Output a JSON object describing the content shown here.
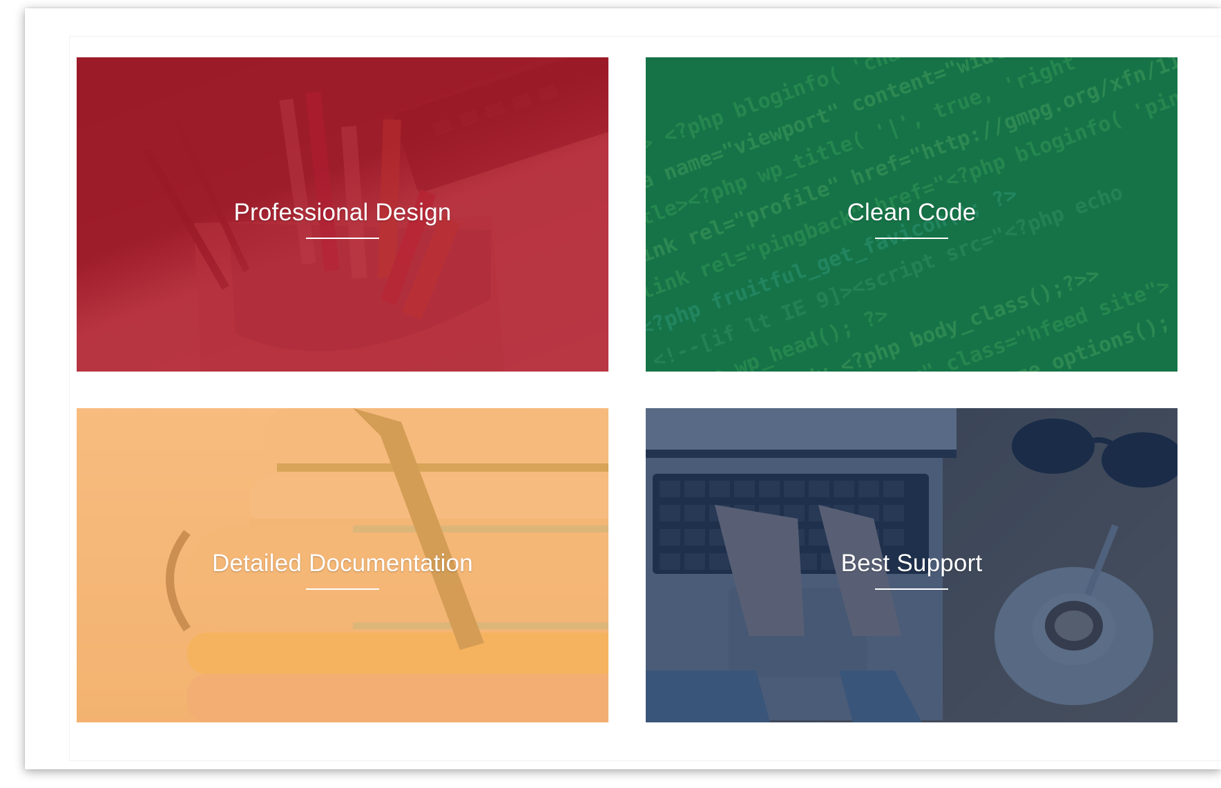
{
  "features": [
    {
      "title": "Professional Design",
      "tint": "#af1828"
    },
    {
      "title": "Clean Code",
      "tint": "#16804e"
    },
    {
      "title": "Detailed Documentation",
      "tint": "#f7aa60"
    },
    {
      "title": "Best Support",
      "tint": "#20375c"
    }
  ]
}
